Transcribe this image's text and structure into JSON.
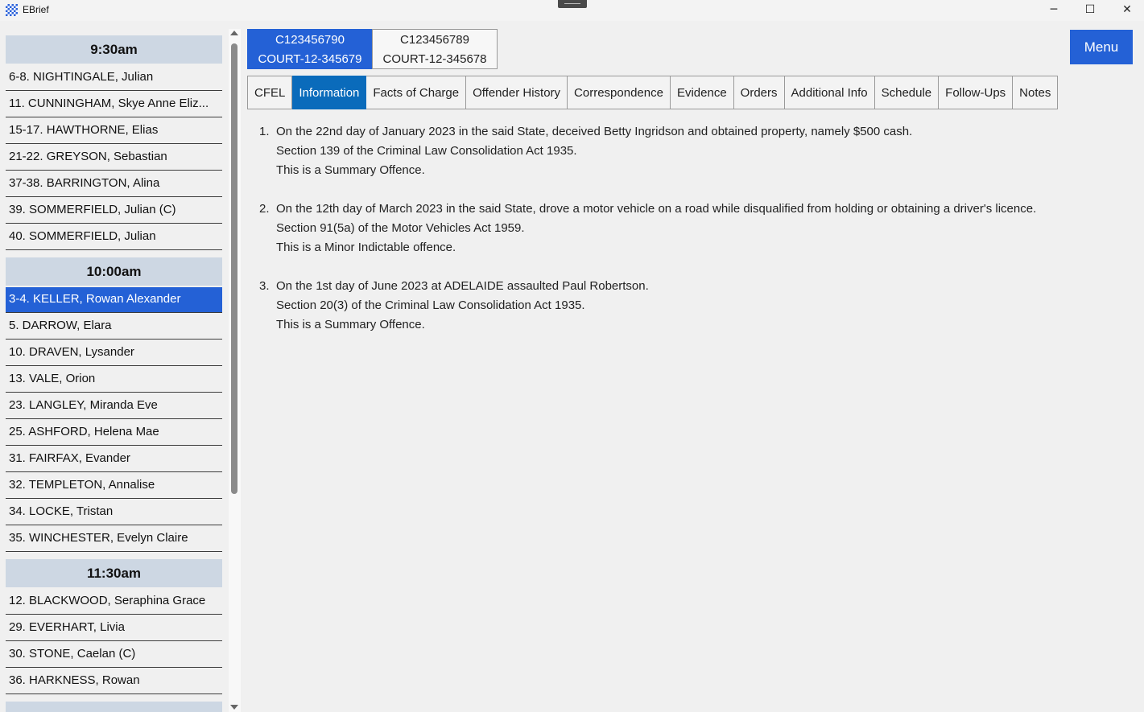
{
  "window": {
    "title": "EBrief",
    "controls": {
      "minimize": "─",
      "maximize": "☐",
      "close": "✕"
    }
  },
  "sidebar": {
    "groups": [
      {
        "time": "9:30am",
        "cases": [
          "6-8. NIGHTINGALE, Julian",
          "11. CUNNINGHAM, Skye Anne Eliz...",
          "15-17. HAWTHORNE, Elias",
          "21-22. GREYSON, Sebastian",
          "37-38. BARRINGTON, Alina",
          "39. SOMMERFIELD, Julian (C)",
          "40. SOMMERFIELD, Julian"
        ]
      },
      {
        "time": "10:00am",
        "cases": [
          "3-4. KELLER, Rowan Alexander",
          "5. DARROW, Elara",
          "10. DRAVEN, Lysander",
          "13. VALE, Orion",
          "23. LANGLEY, Miranda Eve",
          "25. ASHFORD, Helena Mae",
          "31. FAIRFAX, Evander",
          "32. TEMPLETON, Annalise",
          "34. LOCKE, Tristan",
          "35. WINCHESTER, Evelyn Claire"
        ]
      },
      {
        "time": "11:30am",
        "cases": [
          "12. BLACKWOOD, Seraphina Grace",
          "29. EVERHART, Livia",
          "30. STONE, Caelan (C)",
          "36. HARKNESS, Rowan"
        ]
      }
    ],
    "selected_case": "3-4. KELLER, Rowan Alexander"
  },
  "case_tabs": [
    {
      "number": "C123456790",
      "court": "COURT-12-345679",
      "active": true
    },
    {
      "number": "C123456789",
      "court": "COURT-12-345678",
      "active": false
    }
  ],
  "menu_label": "Menu",
  "section_tabs": [
    {
      "label": "CFEL",
      "active": false
    },
    {
      "label": "Information",
      "active": true
    },
    {
      "label": "Facts of Charge",
      "active": false
    },
    {
      "label": "Offender History",
      "active": false
    },
    {
      "label": "Correspondence",
      "active": false
    },
    {
      "label": "Evidence",
      "active": false
    },
    {
      "label": "Orders",
      "active": false
    },
    {
      "label": "Additional Info",
      "active": false
    },
    {
      "label": "Schedule",
      "active": false
    },
    {
      "label": "Follow-Ups",
      "active": false
    },
    {
      "label": "Notes",
      "active": false
    }
  ],
  "offences": [
    {
      "number": "1.",
      "description": "On the 22nd day of January 2023 in the said State, deceived Betty Ingridson and obtained property, namely $500 cash.",
      "section": "Section 139 of the Criminal Law Consolidation Act 1935.",
      "classification": "This is a Summary Offence."
    },
    {
      "number": "2.",
      "description": "On the 12th day of March 2023 in the said State, drove a motor vehicle on a road while disqualified from holding or obtaining a driver's licence.",
      "section": "Section 91(5a) of the Motor Vehicles Act 1959.",
      "classification": "This is a Minor Indictable offence."
    },
    {
      "number": "3.",
      "description": "On the 1st day of June 2023 at ADELAIDE assaulted Paul Robertson.",
      "section": "Section 20(3) of the Criminal Law Consolidation Act 1935.",
      "classification": "This is a Summary Offence."
    }
  ],
  "colors": {
    "accent": "#2461d6",
    "tab_active": "#0a6bbb",
    "time_header_bg": "#cdd7e3",
    "background": "#f0f0f0"
  }
}
